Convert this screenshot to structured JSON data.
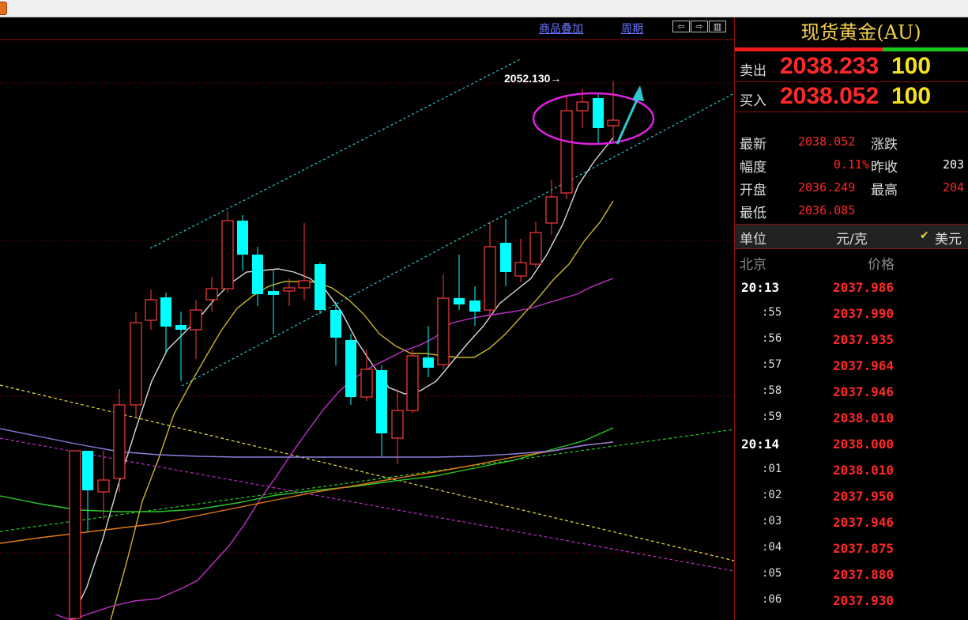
{
  "toolbar": {
    "overlay_link": "商品叠加",
    "period_link": "周期",
    "nav_buttons": [
      "⇦",
      "⇨",
      "▥"
    ]
  },
  "chart": {
    "high_annotation": "2052.130→",
    "high_marker_value": 2052.13,
    "colors": {
      "up_candle": "#ff3b3b",
      "down_candle": "#00ffff",
      "ma_white": "#d8d8d8",
      "ma_yellow": "#c8b62a",
      "ma_magenta": "#c030c8",
      "ma_green": "#28c828",
      "ma_orange": "#e07818",
      "ma_lavender": "#8a80e0",
      "channel": "#30c8d0",
      "circle": "#e020e0"
    },
    "icons": [
      "ellipse-highlight",
      "trend-arrow"
    ]
  },
  "panel": {
    "title": "现货黄金(AU)",
    "sell": {
      "label": "卖出",
      "price": "2038.233",
      "volume": "100"
    },
    "buy": {
      "label": "买入",
      "price": "2038.052",
      "volume": "100"
    },
    "info": {
      "latest_label": "最新",
      "latest_value": "2038.052",
      "change_label": "涨跌",
      "amplitude_label": "幅度",
      "amplitude_value": "0.11%",
      "prev_close_label": "昨收",
      "prev_close_value": "203",
      "open_label": "开盘",
      "open_value": "2036.249",
      "high_label": "最高",
      "high_value": "204",
      "low_label": "最低",
      "low_value": "2036.085"
    },
    "unit": {
      "label": "单位",
      "value": "元/克",
      "currency_check": "✔",
      "currency": "美元"
    },
    "ticks_header": {
      "city": "北京",
      "price": "价格"
    },
    "ticks": [
      {
        "time": "20:13",
        "price": "2037.986"
      },
      {
        "time": ":55",
        "price": "2037.990"
      },
      {
        "time": ":56",
        "price": "2037.935"
      },
      {
        "time": ":57",
        "price": "2037.964"
      },
      {
        "time": ":58",
        "price": "2037.946"
      },
      {
        "time": ":59",
        "price": "2038.010"
      },
      {
        "time": "20:14",
        "price": "2038.000"
      },
      {
        "time": ":01",
        "price": "2038.010"
      },
      {
        "time": ":02",
        "price": "2037.950"
      },
      {
        "time": ":03",
        "price": "2037.946"
      },
      {
        "time": ":04",
        "price": "2037.875"
      },
      {
        "time": ":05",
        "price": "2037.880"
      },
      {
        "time": ":06",
        "price": "2037.930"
      }
    ]
  }
}
